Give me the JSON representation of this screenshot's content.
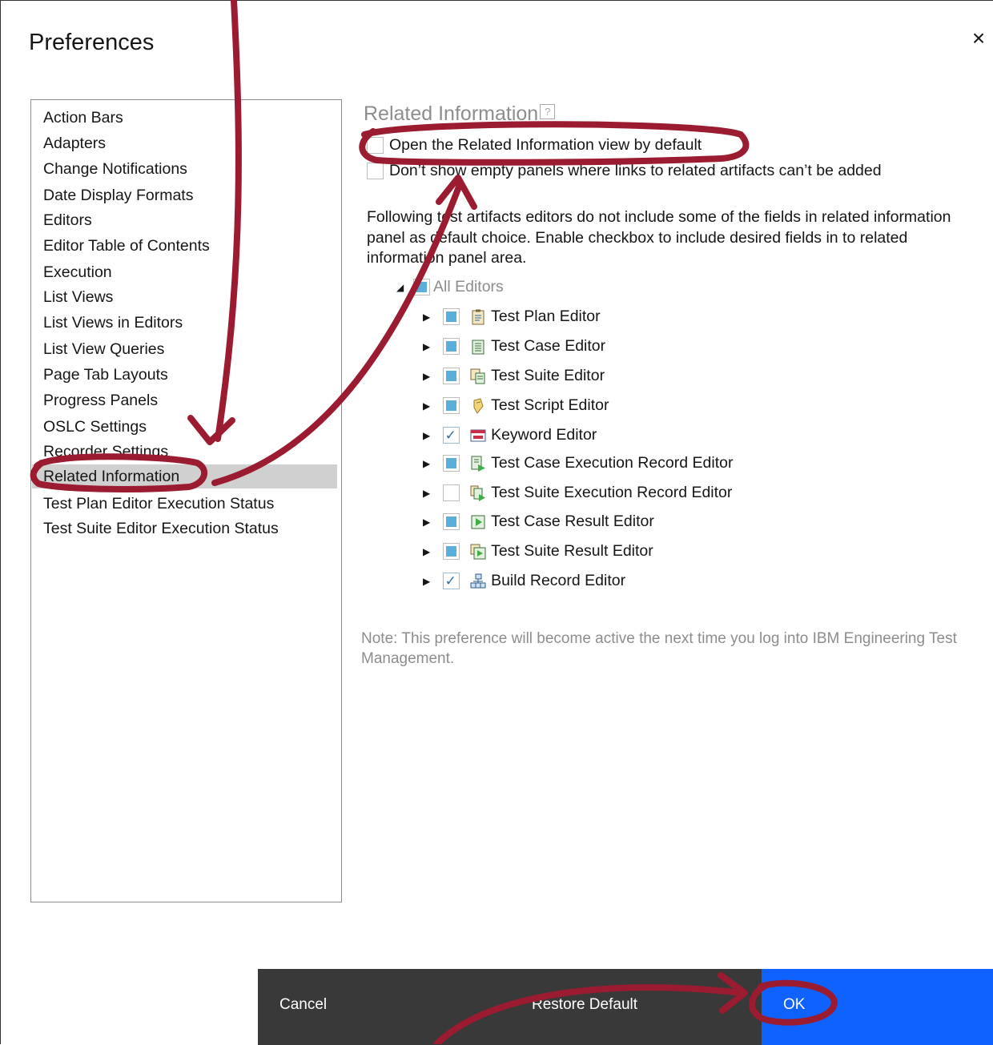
{
  "dialog": {
    "title": "Preferences",
    "close_glyph": "×"
  },
  "nav": {
    "items": [
      {
        "label": "Action Bars"
      },
      {
        "label": "Adapters"
      },
      {
        "label": "Change Notifications"
      },
      {
        "label": "Date Display Formats"
      },
      {
        "label": "Editors"
      },
      {
        "label": "Editor Table of Contents"
      },
      {
        "label": "Execution"
      },
      {
        "label": "List Views"
      },
      {
        "label": "List Views in Editors"
      },
      {
        "label": "List View Queries"
      },
      {
        "label": "Page Tab Layouts"
      },
      {
        "label": "Progress Panels"
      },
      {
        "label": "OSLC Settings"
      },
      {
        "label": "Recorder Settings"
      },
      {
        "label": "Related Information",
        "selected": true
      },
      {
        "label": "Test Plan Editor Execution Status"
      },
      {
        "label": "Test Suite Editor Execution Status"
      }
    ]
  },
  "content": {
    "heading": "Related Information",
    "help_glyph": "?",
    "option_open_default": "Open the Related Information view by default",
    "option_dont_show_empty": "Don’t show empty panels where links to related artifacts can’t be added",
    "description": "Following test artifacts editors do not include some of the fields in related information panel as default choice. Enable checkbox to include desired fields in to related information panel area.",
    "tree": {
      "root_label": "All Editors",
      "root_state": "partial",
      "items": [
        {
          "label": "Test Plan Editor",
          "state": "partial",
          "icon": "test-plan-icon"
        },
        {
          "label": "Test Case Editor",
          "state": "partial",
          "icon": "test-case-icon"
        },
        {
          "label": "Test Suite Editor",
          "state": "partial",
          "icon": "test-suite-icon"
        },
        {
          "label": "Test Script Editor",
          "state": "partial",
          "icon": "test-script-icon"
        },
        {
          "label": "Keyword Editor",
          "state": "checked",
          "icon": "keyword-icon"
        },
        {
          "label": "Test Case Execution Record Editor",
          "state": "partial",
          "icon": "test-case-execution-record-icon"
        },
        {
          "label": "Test Suite Execution Record Editor",
          "state": "unchecked",
          "icon": "test-suite-execution-record-icon"
        },
        {
          "label": "Test Case Result Editor",
          "state": "partial",
          "icon": "test-case-result-icon"
        },
        {
          "label": "Test Suite Result Editor",
          "state": "partial",
          "icon": "test-suite-result-icon"
        },
        {
          "label": "Build Record Editor",
          "state": "checked",
          "icon": "build-record-icon"
        }
      ]
    },
    "note": "Note: This preference will become active the next time you log into IBM Engineering Test Management."
  },
  "footer": {
    "cancel_label": "Cancel",
    "restore_label": "Restore Default",
    "ok_label": "OK"
  },
  "colors": {
    "accent": "#0f62fe",
    "footer": "#393939",
    "annotation": "#9b1b30"
  }
}
